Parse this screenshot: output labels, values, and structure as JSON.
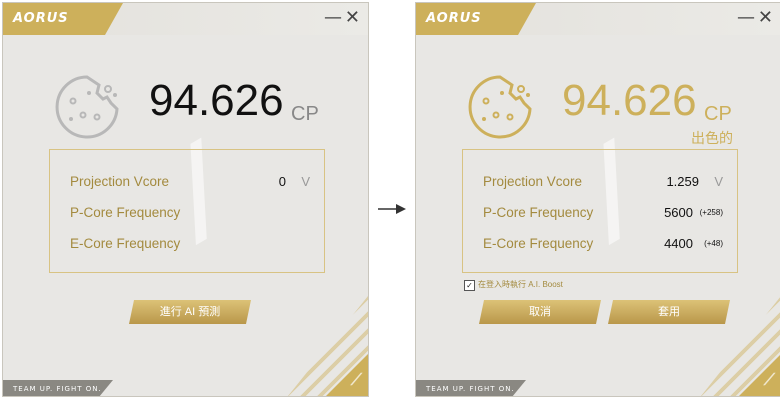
{
  "colors": {
    "accent": "#cdb05b",
    "background": "#e8e7e4",
    "text_dark": "#111111"
  },
  "windows": [
    {
      "logo": "AORUS",
      "minimize": "—",
      "close": "✕",
      "score": "94.626",
      "unit": "CP",
      "metrics": [
        {
          "label": "Projection Vcore",
          "value": "0",
          "unit": "V"
        },
        {
          "label": "P-Core Frequency"
        },
        {
          "label": "E-Core Frequency"
        }
      ],
      "predict_button": "進行 AI 預測",
      "footer": "TEAM UP. FIGHT ON."
    },
    {
      "logo": "AORUS",
      "minimize": "—",
      "close": "✕",
      "score": "94.626",
      "unit": "CP",
      "status": "出色的",
      "metrics": [
        {
          "label": "Projection Vcore",
          "value": "1.259",
          "unit": "V"
        },
        {
          "label": "P-Core Frequency",
          "value": "5600",
          "delta": "(+258)"
        },
        {
          "label": "E-Core Frequency",
          "value": "4400",
          "delta": "(+48)"
        }
      ],
      "checkbox_label": "在登入時執行 A.I. Boost",
      "checkbox_checked": true,
      "cancel_button": "取消",
      "apply_button": "套用",
      "footer": "TEAM UP. FIGHT ON."
    }
  ],
  "icons": [
    "cookie-icon",
    "arrow-right-icon",
    "minimize-icon",
    "close-icon"
  ]
}
